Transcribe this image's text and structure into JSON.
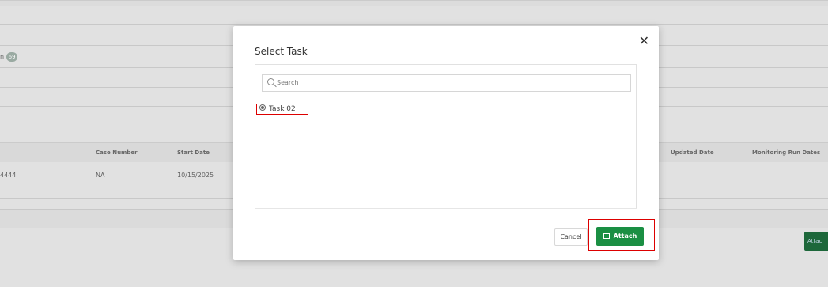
{
  "background": {
    "badge_text": "n",
    "badge_count": "69",
    "table_headers": [
      "Case Number",
      "Start Date",
      "Updated Date",
      "Monitoring Run Dates"
    ],
    "row": {
      "id": "4444",
      "case_number": "NA",
      "start_date": "10/15/2025"
    },
    "attach_label": "Attac"
  },
  "modal": {
    "title": "Select Task",
    "close_icon": "close-icon",
    "search_placeholder": "Search",
    "task_option": "Task 02",
    "cancel_label": "Cancel",
    "attach_label": "Attach"
  },
  "colors": {
    "accent": "#1a8f43",
    "highlight": "#dd0000"
  }
}
